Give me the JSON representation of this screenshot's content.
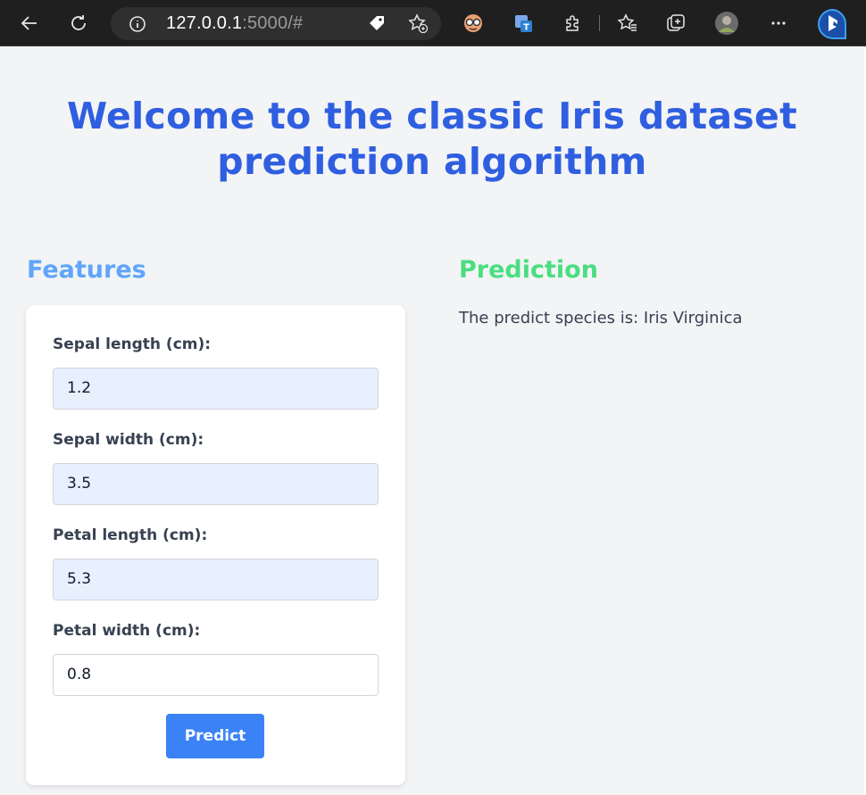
{
  "browser": {
    "url_host": "127.0.0.1",
    "url_rest": ":5000/#",
    "icons": [
      "back-icon",
      "refresh-icon",
      "info-icon",
      "tag-icon",
      "add-favorite-icon",
      "extension-glasses-icon",
      "translate-icon",
      "extensions-icon",
      "favorites-icon",
      "collections-icon",
      "profile-avatar",
      "more-icon",
      "bing-icon"
    ]
  },
  "page": {
    "title": "Welcome to the classic Iris dataset prediction algorithm",
    "features_heading": "Features",
    "prediction_heading": "Prediction",
    "prediction_text": "The predict species is: Iris Virginica"
  },
  "form": {
    "sepal_length_label": "Sepal length (cm):",
    "sepal_length_value": "1.2",
    "sepal_width_label": "Sepal width (cm):",
    "sepal_width_value": "3.5",
    "petal_length_label": "Petal length (cm):",
    "petal_length_value": "5.3",
    "petal_width_label": "Petal width (cm):",
    "petal_width_value": "0.8",
    "predict_label": "Predict"
  },
  "colors": {
    "title": "#2f5fe0",
    "features_heading": "#60a5fa",
    "prediction_heading": "#4ade80",
    "button": "#3b82f6"
  }
}
